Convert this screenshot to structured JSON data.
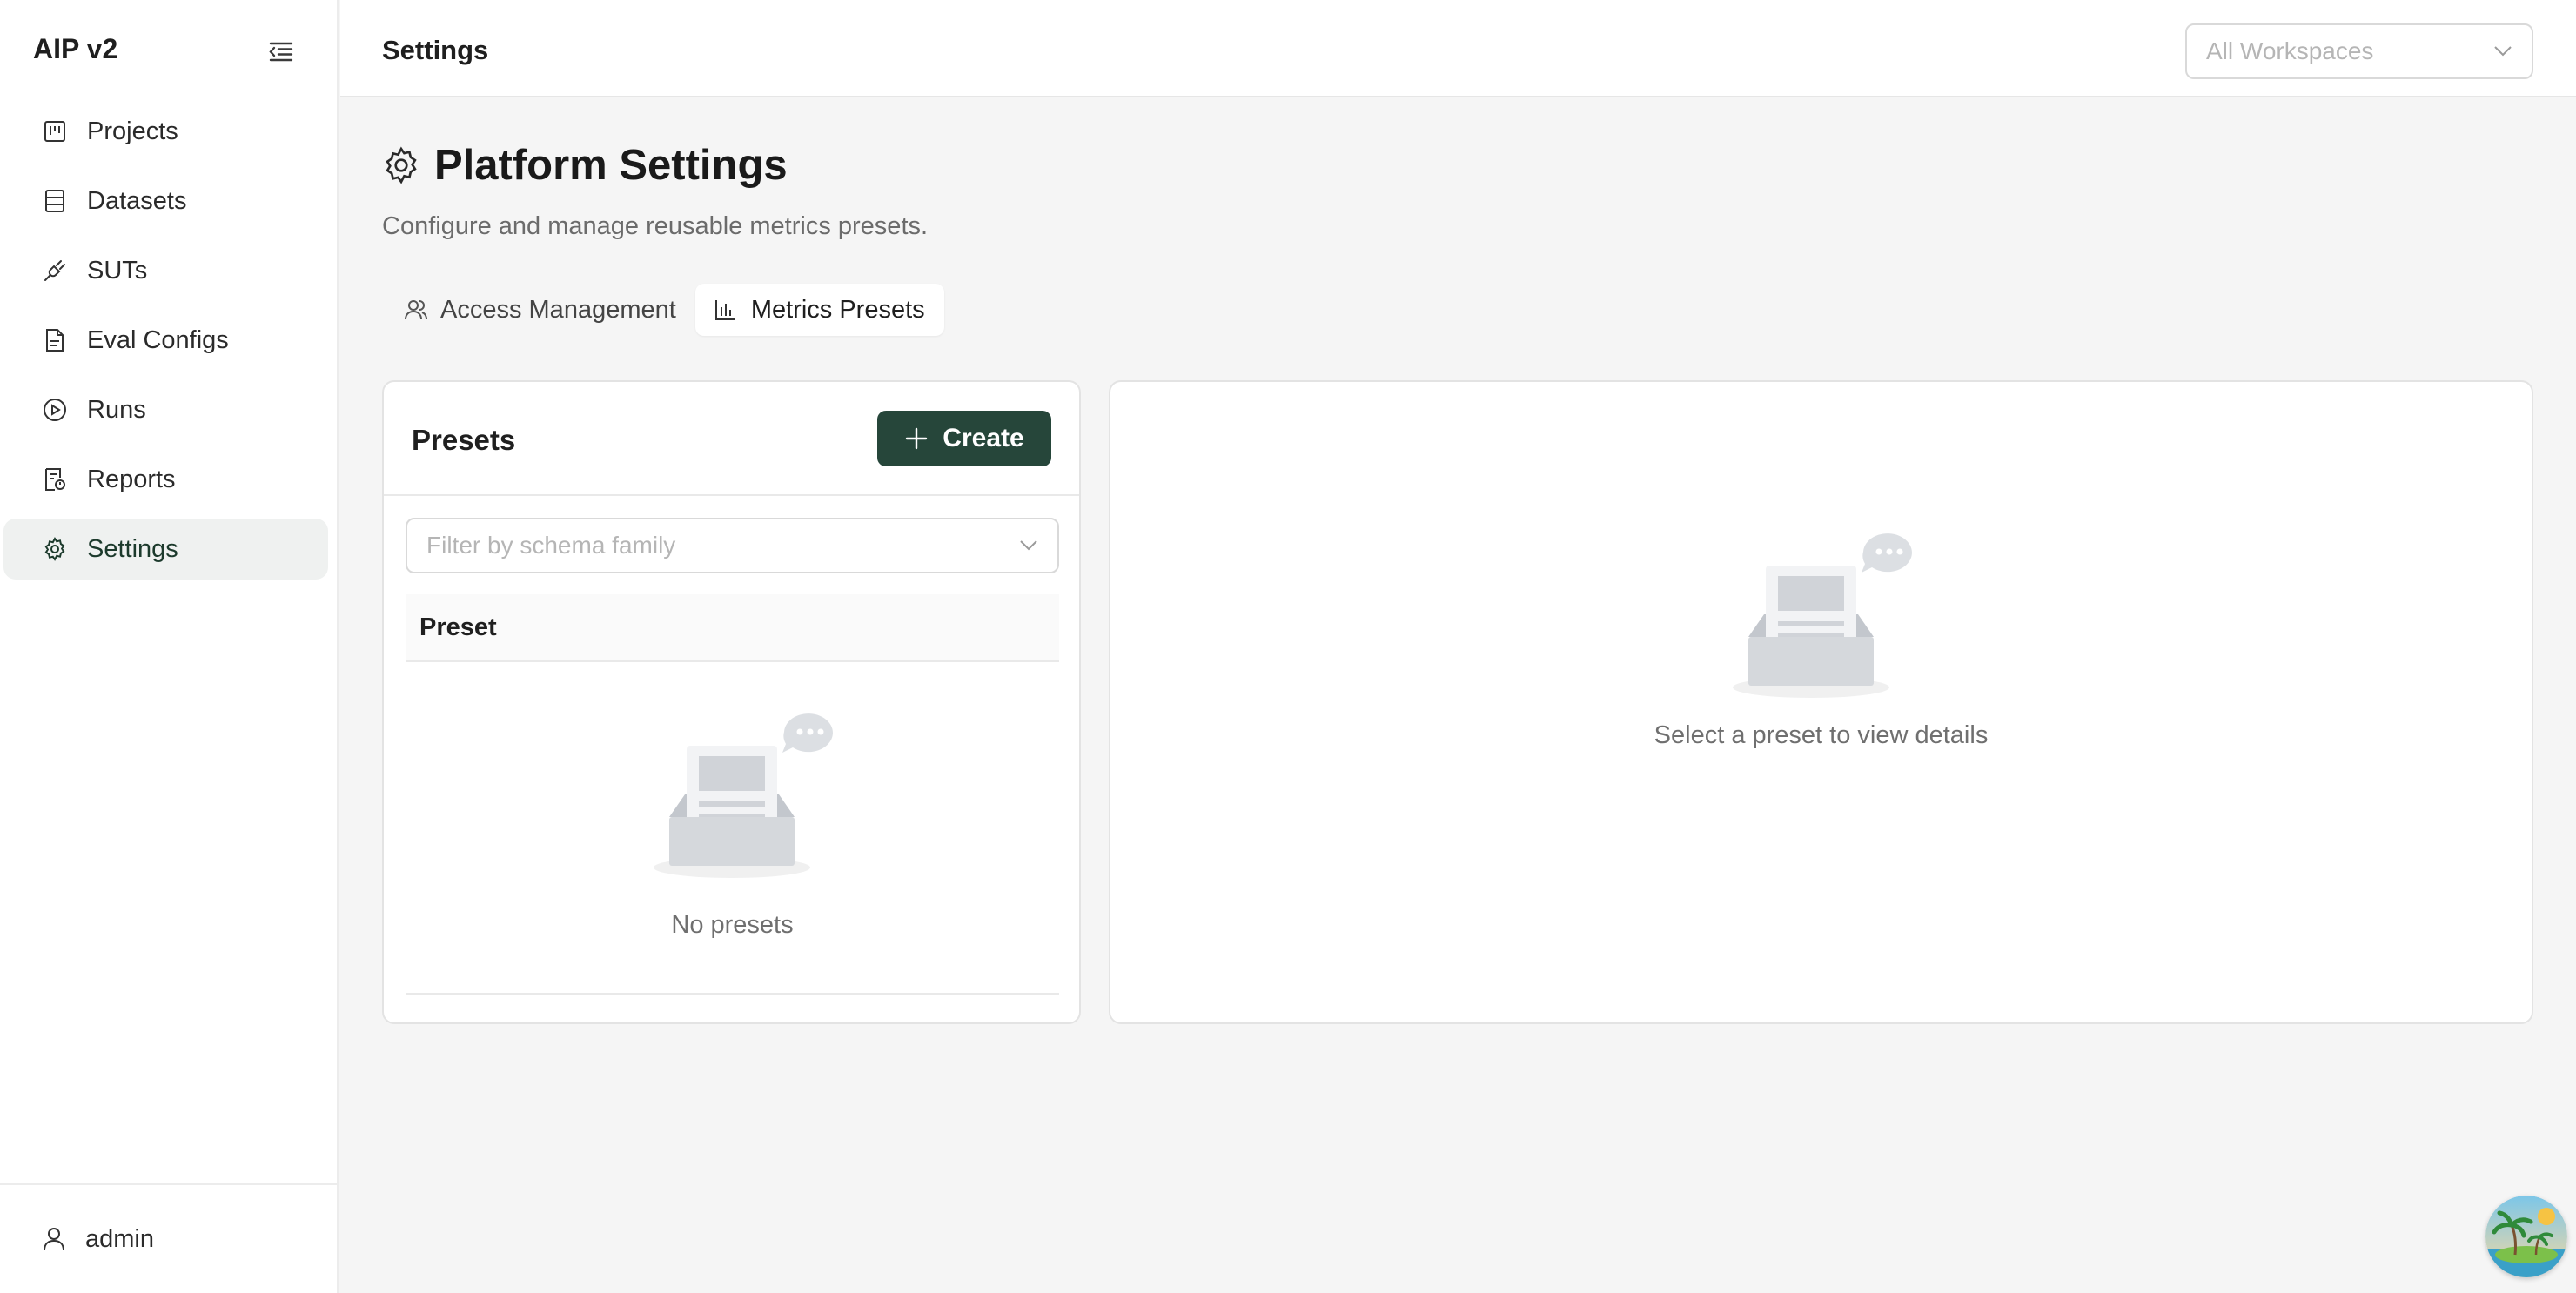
{
  "app": {
    "name": "AIP v2"
  },
  "sidebar": {
    "items": [
      {
        "label": "Projects",
        "icon": "kanban-icon"
      },
      {
        "label": "Datasets",
        "icon": "database-icon"
      },
      {
        "label": "SUTs",
        "icon": "plug-icon"
      },
      {
        "label": "Eval Configs",
        "icon": "file-config-icon"
      },
      {
        "label": "Runs",
        "icon": "play-circle-icon"
      },
      {
        "label": "Reports",
        "icon": "report-icon"
      },
      {
        "label": "Settings",
        "icon": "gear-icon"
      }
    ],
    "active": "Settings",
    "user": {
      "label": "admin",
      "icon": "user-icon"
    }
  },
  "header": {
    "title": "Settings",
    "workspace_select": {
      "placeholder": "All Workspaces"
    }
  },
  "page": {
    "title": "Platform Settings",
    "subtitle": "Configure and manage reusable metrics presets.",
    "tabs": [
      {
        "label": "Access Management",
        "icon": "users-icon"
      },
      {
        "label": "Metrics Presets",
        "icon": "bar-chart-icon"
      }
    ],
    "active_tab": "Metrics Presets"
  },
  "presets": {
    "title": "Presets",
    "create_label": "Create",
    "filter_placeholder": "Filter by schema family",
    "column_header": "Preset",
    "empty_text": "No presets"
  },
  "detail": {
    "empty_text": "Select a preset to view details"
  },
  "colors": {
    "accent": "#26463a",
    "active_nav_bg": "#eff1f0"
  }
}
